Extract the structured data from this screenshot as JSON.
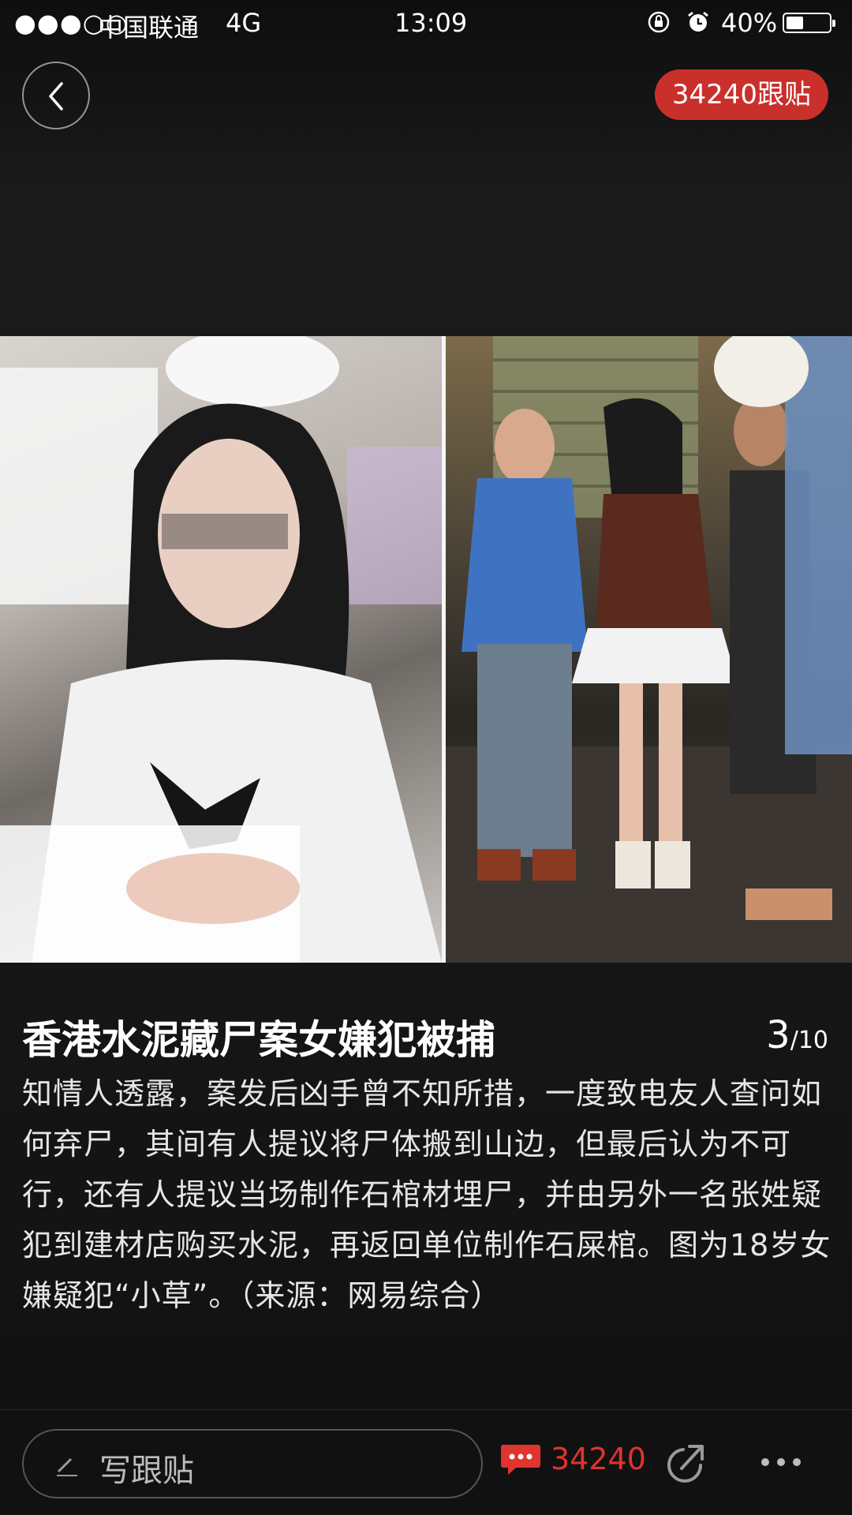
{
  "status_bar": {
    "signal": "●●●○○",
    "carrier": "中国联通",
    "network": "4G",
    "time": "13:09",
    "battery_percent": "40%",
    "battery_level": 0.4
  },
  "header": {
    "comment_badge": "34240跟贴"
  },
  "caption": {
    "title": "香港水泥藏尸案女嫌犯被捕",
    "page_current": "3",
    "page_total": "/10",
    "body": "知情人透露，案发后凶手曾不知所措，一度致电友人查问如何弃尸，其间有人提议将尸体搬到山边，但最后认为不可行，还有人提议当场制作石棺材埋尸，并由另外一名张姓疑犯到建材店购买水泥，再返回单位制作石屎棺。图为18岁女嫌疑犯“小草”。（来源：网易综合）"
  },
  "bottom_bar": {
    "comment_placeholder": "写跟贴",
    "comment_count": "34240"
  },
  "colors": {
    "accent_red": "#c9302c",
    "count_red": "#e0342e"
  }
}
